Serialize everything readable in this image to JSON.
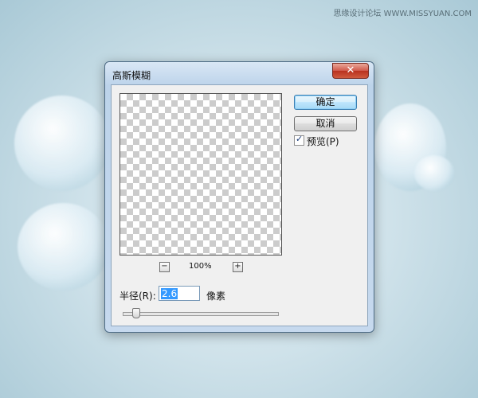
{
  "watermark": "思缘设计论坛 WWW.MISSYUAN.COM",
  "dialog": {
    "title": "高斯模糊",
    "close_icon": "close-x-icon",
    "ok_label": "确定",
    "cancel_label": "取消",
    "preview_checkbox": {
      "label": "预览(P)",
      "checked": true
    },
    "zoom": {
      "minus": "−",
      "level": "100%",
      "plus": "+"
    },
    "radius": {
      "label": "半径(R):",
      "value": "2.6",
      "unit": "像素"
    },
    "slider": {
      "value": 2.6
    }
  },
  "colors": {
    "background": "#cfe2ea",
    "titlebar": "#bcd3ea",
    "close_button": "#c7432f",
    "selection": "#3399ff"
  }
}
